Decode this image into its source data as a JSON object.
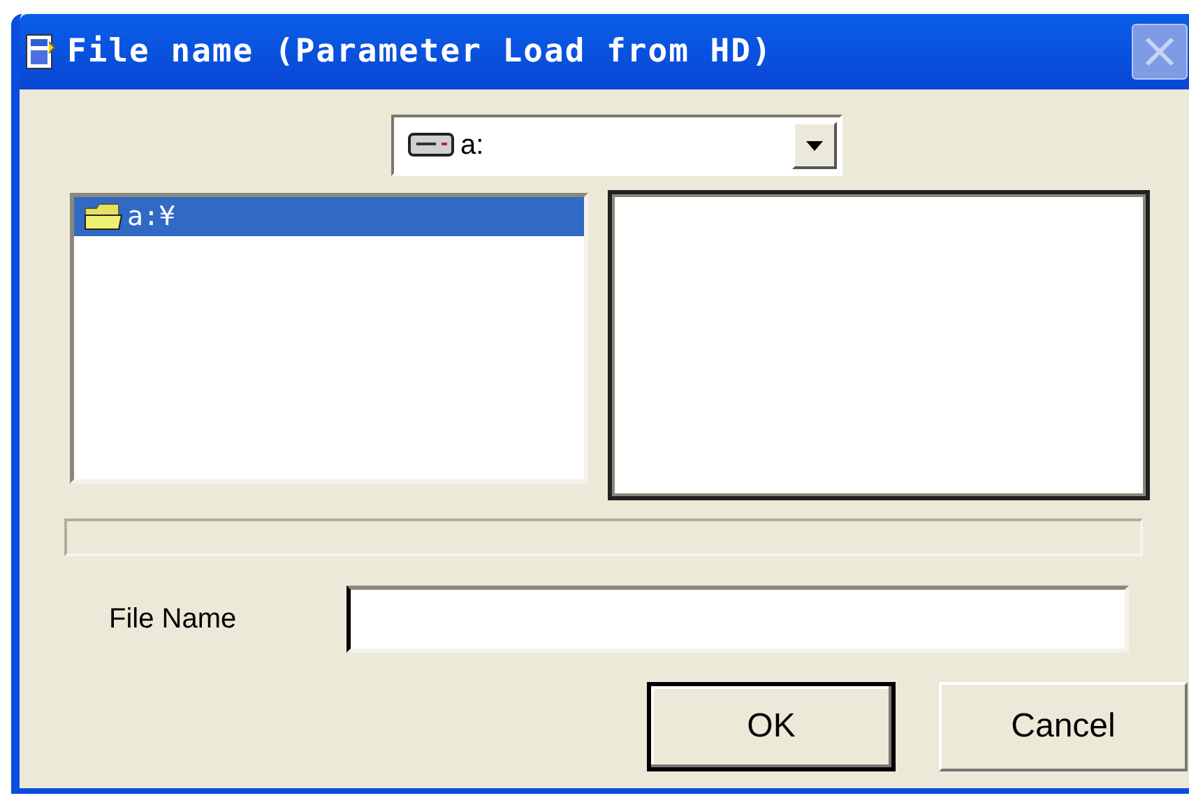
{
  "window": {
    "title": "File name (Parameter Load from HD)"
  },
  "drive_select": {
    "value": "a:"
  },
  "folders": [
    {
      "label": "a:¥",
      "selected": true
    }
  ],
  "file_name": {
    "label": "File Name"
  },
  "buttons": [
    {
      "label": "OK",
      "default": true
    },
    {
      "label": "Cancel",
      "default": false
    }
  ]
}
